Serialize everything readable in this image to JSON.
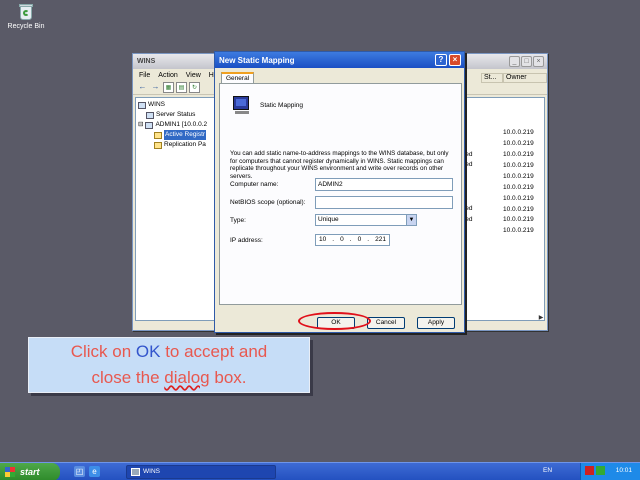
{
  "desktop": {
    "recycle_bin_label": "Recycle Bin"
  },
  "mmc": {
    "title": "WINS",
    "menu": [
      "File",
      "Action",
      "View",
      "H"
    ],
    "tree": [
      {
        "label": "WINS"
      },
      {
        "label": "Server Status"
      },
      {
        "label": "ADMIN1 [10.0.0.2"
      },
      {
        "label": "Active Registr"
      },
      {
        "label": "Replication Pa"
      }
    ],
    "columns": [
      "St...",
      "Owner"
    ],
    "status_fragments": [
      "sed",
      "sed",
      "sed",
      "sed"
    ],
    "owners": [
      "10.0.0.219",
      "10.0.0.219",
      "10.0.0.219",
      "10.0.0.219",
      "10.0.0.219",
      "10.0.0.219",
      "10.0.0.219",
      "10.0.0.219",
      "10.0.0.219",
      "10.0.0.219"
    ]
  },
  "dialog": {
    "title": "New Static Mapping",
    "tab": "General",
    "heading": "Static Mapping",
    "description": "You can add static name-to-address mappings to the WINS database, but only for computers that cannot register dynamically in WINS. Static mappings can replicate throughout your WINS environment and write over records on other servers.",
    "computer_name_label": "Computer name:",
    "computer_name_value": "ADMIN2",
    "netbios_label": "NetBIOS scope (optional):",
    "netbios_value": "",
    "type_label": "Type:",
    "type_value": "Unique",
    "ip_label": "IP address:",
    "ip_octets": [
      "10",
      "0",
      "0",
      "221"
    ],
    "ok": "OK",
    "cancel": "Cancel",
    "apply": "Apply"
  },
  "caption": {
    "line1_a": "Click on ",
    "line1_ok": "OK",
    "line1_b": " to accept and",
    "line2_a": "close the ",
    "line2_wavy": "dialog",
    "line2_b": " box."
  },
  "taskbar": {
    "start": "start",
    "task_label": "WINS",
    "lang": "EN",
    "clock": "10:01"
  },
  "colors": {
    "highlight_ring": "#e0101a",
    "caption_text": "#e8584f",
    "caption_accent": "#3355cc"
  }
}
